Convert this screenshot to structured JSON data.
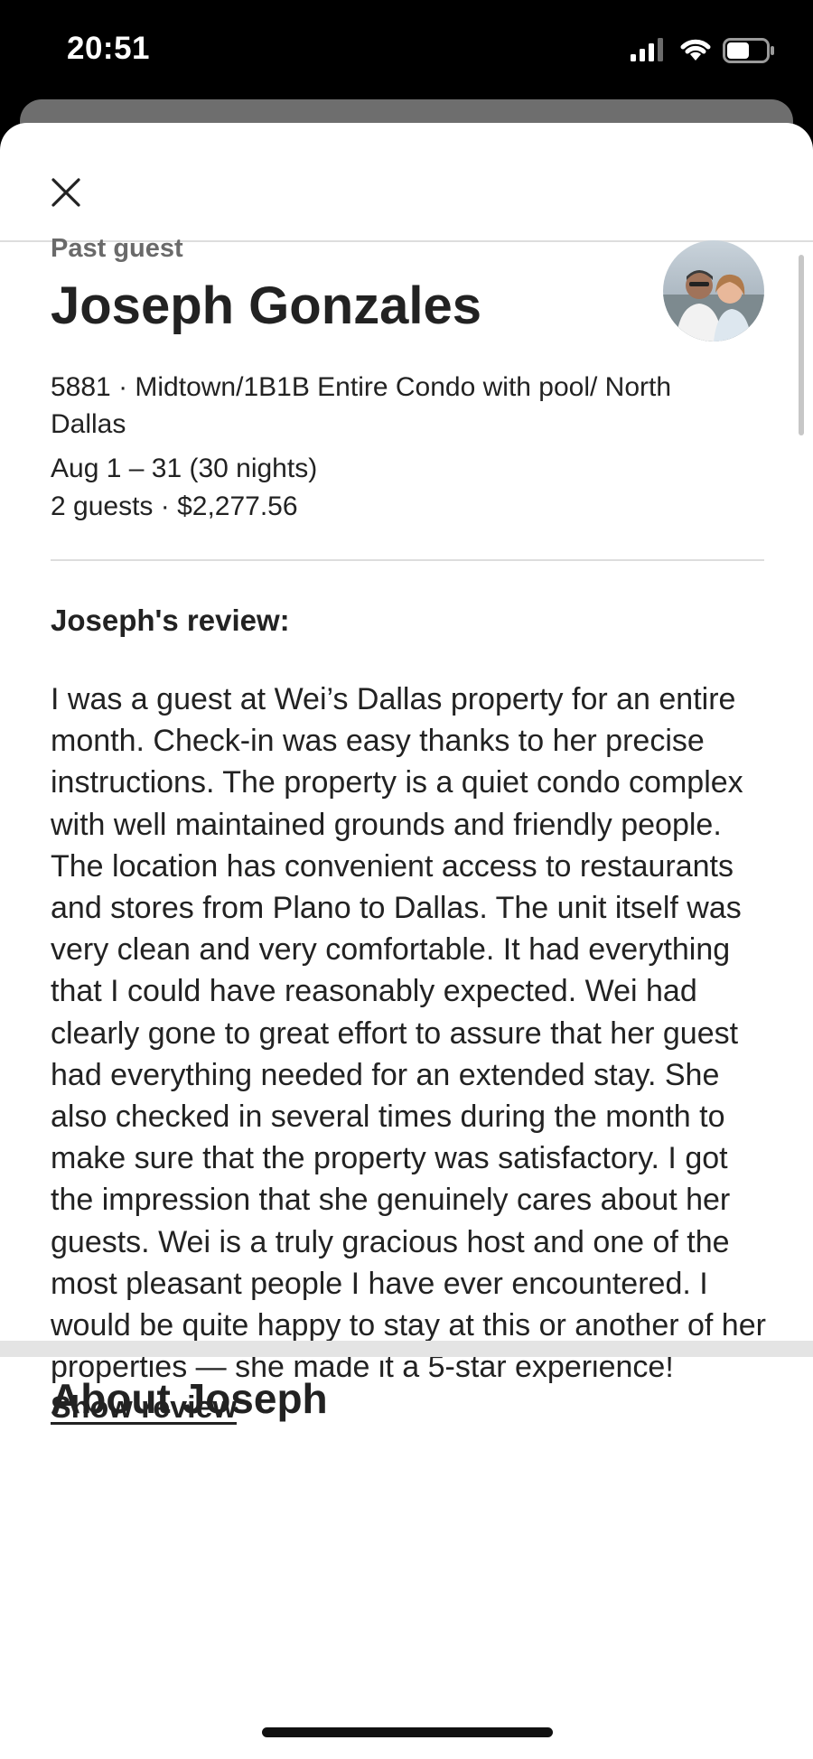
{
  "status_bar": {
    "time": "20:51"
  },
  "header": {
    "close_icon": "close-icon"
  },
  "guest": {
    "label": "Past guest",
    "name": "Joseph Gonzales",
    "listing": "5881 · Midtown/1B1B Entire Condo with pool/ North Dallas",
    "dates": "Aug 1 – 31 (30 nights)",
    "guests_price": "2 guests · $2,277.56"
  },
  "review": {
    "heading": "Joseph's review:",
    "body": "I was a guest at Wei’s Dallas property for an entire month. Check-in was easy thanks to her precise instructions. The property is a quiet condo complex with well maintained grounds and friendly people. The location has convenient access to restaurants and stores from Plano to Dallas. The unit itself was very clean and very comfortable. It had everything that I could have reasonably expected. Wei had clearly gone to great effort to assure that her guest had everything needed for an extended stay. She also checked in several times during the month to make sure that the property was satisfactory. I got the impression that she genuinely cares about her guests. Wei is a truly gracious host and one of the most pleasant people I have ever encountered. I would be quite happy to stay at this or another of her properties — she made it a 5-star experience!",
    "show_label": "Show review"
  },
  "about": {
    "heading": "About Joseph"
  }
}
